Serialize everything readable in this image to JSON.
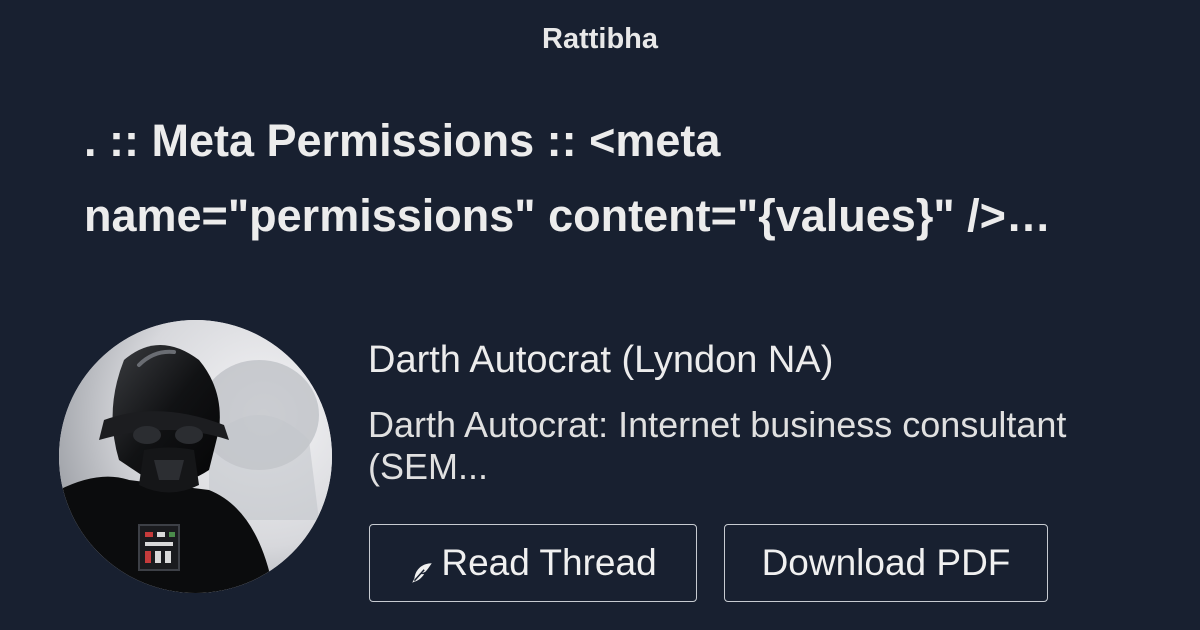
{
  "brand": "Rattibha",
  "thread": {
    "title": ". :: Meta Permissions :: <meta name=\"permissions\" content=\"{values}\" />…"
  },
  "author": {
    "name": "Darth Autocrat (Lyndon NA)",
    "bio": "Darth Autocrat: Internet business consultant (SEM..."
  },
  "buttons": {
    "read_label": "Read Thread",
    "read_icon": "feather-icon",
    "pdf_label": "Download PDF"
  },
  "colors": {
    "background": "#182030",
    "text": "#ececec",
    "button_border": "#c7cbd1"
  }
}
